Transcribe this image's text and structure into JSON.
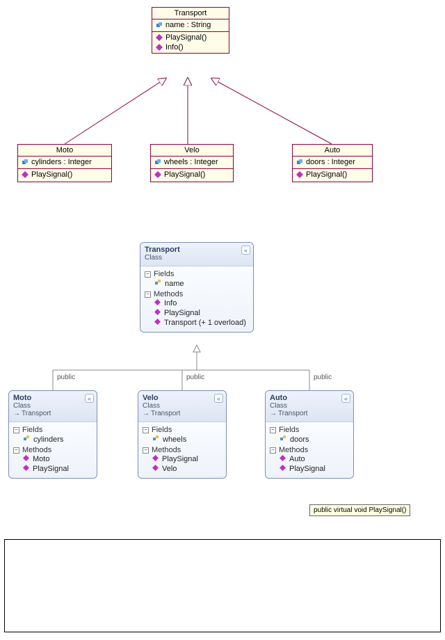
{
  "uml1": {
    "transport": {
      "title": "Transport",
      "attr": "name : String",
      "methods": [
        "PlaySignal()",
        "Info()"
      ]
    },
    "moto": {
      "title": "Moto",
      "attr": "cylinders : Integer",
      "methods": [
        "PlaySignal()"
      ]
    },
    "velo": {
      "title": "Velo",
      "attr": "wheels : Integer",
      "methods": [
        "PlaySignal()"
      ]
    },
    "auto": {
      "title": "Auto",
      "attr": "doors : Integer",
      "methods": [
        "PlaySignal()"
      ]
    }
  },
  "uml2": {
    "public_label": "public",
    "fields_label": "Fields",
    "methods_label": "Methods",
    "class_label": "Class",
    "inherit_arrow": "→",
    "transport": {
      "title": "Transport",
      "fields": [
        "name"
      ],
      "methods": [
        "Info",
        "PlaySignal",
        "Transport (+ 1 overload)"
      ]
    },
    "moto": {
      "title": "Moto",
      "parent": "Transport",
      "fields": [
        "cylinders"
      ],
      "methods": [
        "Moto",
        "PlaySignal"
      ]
    },
    "velo": {
      "title": "Velo",
      "parent": "Transport",
      "fields": [
        "wheels"
      ],
      "methods": [
        "PlaySignal",
        "Velo"
      ]
    },
    "auto": {
      "title": "Auto",
      "parent": "Transport",
      "fields": [
        "doors"
      ],
      "methods": [
        "Auto",
        "PlaySignal"
      ]
    }
  },
  "tooltip": "public virtual void PlaySignal()"
}
